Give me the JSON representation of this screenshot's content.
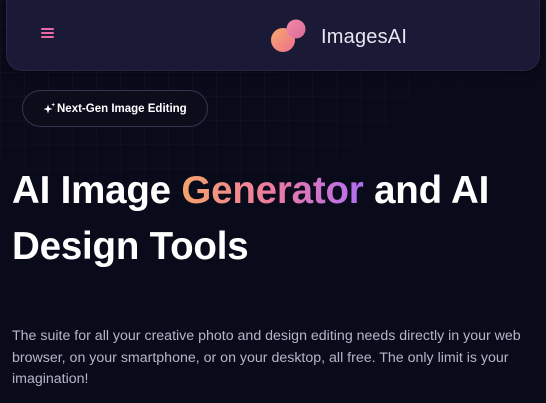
{
  "navbar": {
    "menu_icon": "hamburger-menu-icon",
    "logo_icon": "imagesai-logo-icon",
    "brand_name": "ImagesAI"
  },
  "badge": {
    "icon": "sparkle-icon",
    "label": "Next-Gen Image Editing"
  },
  "hero": {
    "title_part1": "AI Image ",
    "title_highlight": "Generator",
    "title_part2": " and AI Design Tools",
    "description": "The suite for all your creative photo and design editing needs directly in your web browser, on your smartphone, or on your desktop, all free. The only limit is your imagination!"
  },
  "colors": {
    "background": "#0a0b1a",
    "navbar": "#1a1a36",
    "menu_icon": "#e86aa4",
    "gradient_start": "#f5a26b",
    "gradient_mid": "#ee7aa0",
    "gradient_end": "#b16ff5",
    "description_text": "#b4b6c8"
  }
}
